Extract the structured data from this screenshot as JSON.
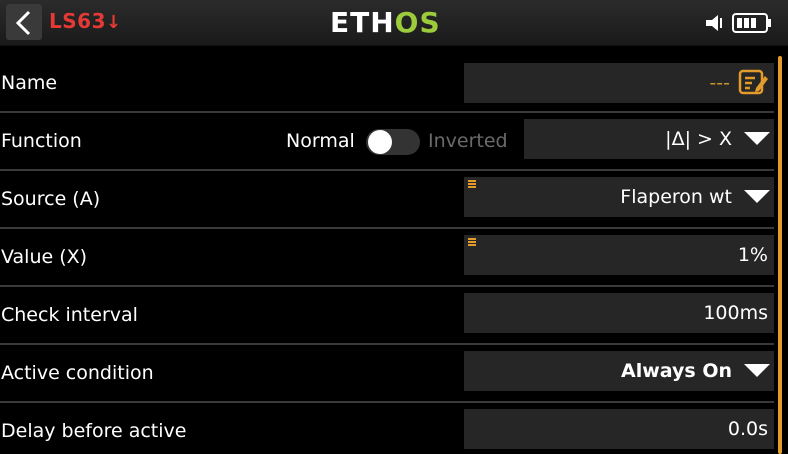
{
  "header": {
    "screen_id": "LS63",
    "logo_part1": "ETH",
    "logo_part2": "OS",
    "icons": [
      "back-arrow-icon",
      "speaker-icon",
      "battery-icon"
    ]
  },
  "rows": {
    "name": {
      "label": "Name",
      "value": "---",
      "icon": "edit-icon"
    },
    "function": {
      "label": "Function",
      "toggle_off_label": "Normal",
      "toggle_on_label": "Inverted",
      "toggle_state": "off",
      "value": "|Δ| > X"
    },
    "source": {
      "label": "Source (A)",
      "value": "Flaperon wt"
    },
    "value": {
      "label": "Value (X)",
      "value": "1%"
    },
    "check_interval": {
      "label": "Check interval",
      "value": "100ms"
    },
    "active_condition": {
      "label": "Active condition",
      "value": "Always On"
    },
    "delay_before_active": {
      "label": "Delay before active",
      "value": "0.0s"
    }
  },
  "colors": {
    "accent": "#e39b2c",
    "title_red": "#e53935",
    "logo_green": "#9ccc3c",
    "field_bg": "#262626"
  }
}
